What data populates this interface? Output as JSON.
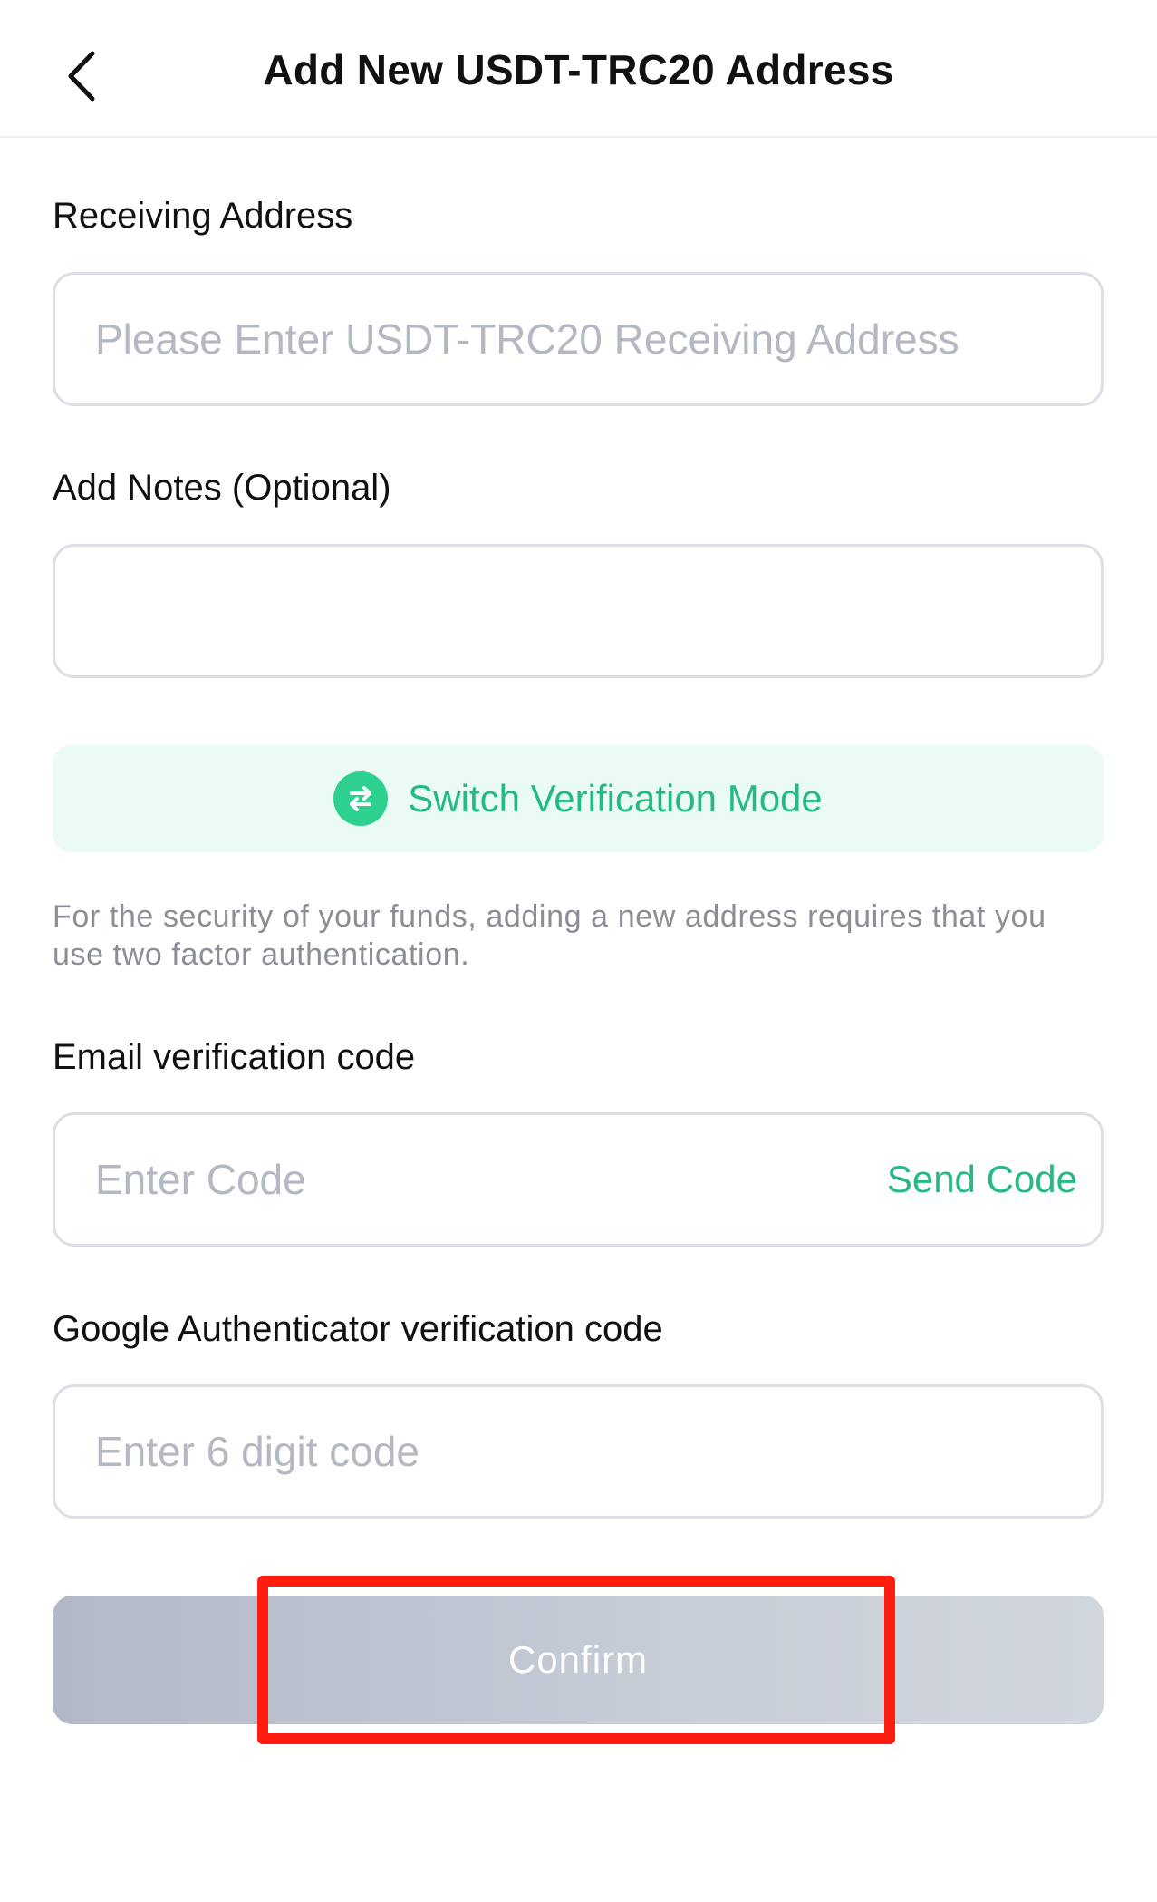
{
  "header": {
    "title": "Add New USDT-TRC20 Address",
    "back_icon": "chevron-left-icon"
  },
  "receiving_address": {
    "label": "Receiving Address",
    "placeholder": "Please Enter USDT-TRC20 Receiving Address",
    "value": ""
  },
  "notes": {
    "label": "Add Notes (Optional)",
    "placeholder": "",
    "value": ""
  },
  "switch_mode": {
    "label": "Switch Verification Mode",
    "icon": "swap-arrows-icon"
  },
  "notice": {
    "text": "For the security of your funds, adding a new address requires that you use two factor authentication."
  },
  "email_code": {
    "label": "Email verification code",
    "placeholder": "Enter Code",
    "value": "",
    "send_label": "Send Code"
  },
  "google_code": {
    "label": "Google Authenticator verification code",
    "placeholder": "Enter 6 digit code",
    "value": ""
  },
  "confirm": {
    "label": "Confirm"
  },
  "colors": {
    "accent_green": "#26b982",
    "icon_green": "#2ed08f",
    "switch_bg": "#eafbf4",
    "highlight_red": "#ff1d10",
    "button_disabled": "#c6ccd6"
  }
}
